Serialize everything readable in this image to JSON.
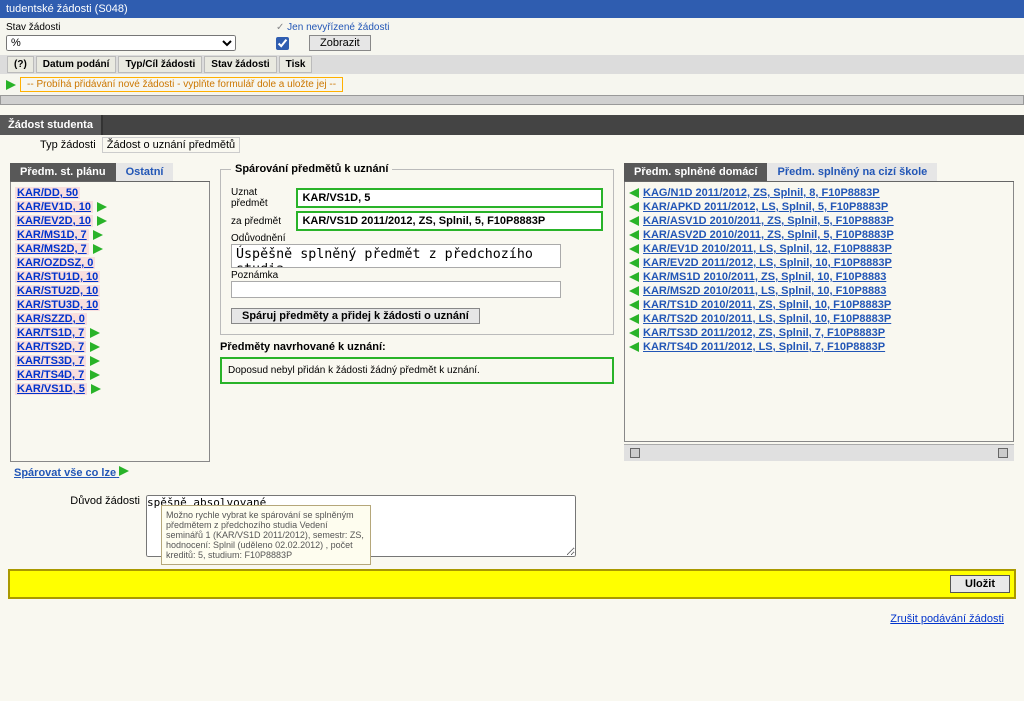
{
  "window_title": "tudentské žádosti (S048)",
  "filter": {
    "state_label": "Stav žádosti",
    "state_value": "%",
    "pending_label": "Jen nevyřízené žádosti",
    "show_btn": "Zobrazit"
  },
  "cols": [
    "(?)",
    "Datum podání",
    "Typ/Cíl žádosti",
    "Stav žádosti",
    "Tisk"
  ],
  "notice": "-- Probíhá přidávání nové žádosti - vyplňte formulář dole a uložte jej --",
  "main_tab": "Žádost studenta",
  "type_label": "Typ žádosti",
  "type_value": "Žádost o uznání předmětů",
  "left": {
    "tab_a": "Předm. st. plánu",
    "tab_b": "Ostatní",
    "items": [
      {
        "t": "KAR/DD, 50",
        "a": false
      },
      {
        "t": "KAR/EV1D, 10",
        "a": true
      },
      {
        "t": "KAR/EV2D, 10",
        "a": true
      },
      {
        "t": "KAR/MS1D, 7",
        "a": true
      },
      {
        "t": "KAR/MS2D, 7",
        "a": true
      },
      {
        "t": "KAR/OZDSZ, 0",
        "a": false
      },
      {
        "t": "KAR/STU1D, 10",
        "a": false
      },
      {
        "t": "KAR/STU2D, 10",
        "a": false
      },
      {
        "t": "KAR/STU3D, 10",
        "a": false
      },
      {
        "t": "KAR/SZZD, 0",
        "a": false
      },
      {
        "t": "KAR/TS1D, 7",
        "a": true
      },
      {
        "t": "KAR/TS2D, 7",
        "a": true
      },
      {
        "t": "KAR/TS3D, 7",
        "a": true
      },
      {
        "t": "KAR/TS4D, 7",
        "a": true
      },
      {
        "t": "KAR/VS1D, 5",
        "a": true
      }
    ],
    "pair_all": "Spárovat vše co lze"
  },
  "pair": {
    "legend": "Spárování předmětů k uznání",
    "recognize_label": "Uznat předmět",
    "recognize_value": "KAR/VS1D, 5",
    "for_label": "za předmět",
    "for_value": "KAR/VS1D 2011/2012, ZS, Splnil, 5, F10P8883P",
    "justif_label": "Odůvodnění",
    "justif_value": "Úspěšně splněný předmět z předchozího studia",
    "note_label": "Poznámka",
    "button": "Spáruj předměty a přidej k žádosti o uznání"
  },
  "proposed": {
    "legend": "Předměty navrhované k uznání:",
    "empty": "Doposud nebyl přidán k žádosti žádný předmět k uznání."
  },
  "right": {
    "tab_a": "Předm. splněné domácí",
    "tab_b": "Předm. splněný na cizí škole",
    "items": [
      "KAG/N1D 2011/2012, ZS, Splnil, 8, F10P8883P",
      "KAR/APKD 2011/2012, LS, Splnil, 5, F10P8883P",
      "KAR/ASV1D 2010/2011, ZS, Splnil, 5, F10P8883P",
      "KAR/ASV2D 2010/2011, ZS, Splnil, 5, F10P8883P",
      "KAR/EV1D 2010/2011, LS, Splnil, 12, F10P8883P",
      "KAR/EV2D 2011/2012, LS, Splnil, 10, F10P8883P",
      "KAR/MS1D 2010/2011, ZS, Splnil, 10, F10P8883",
      "KAR/MS2D 2010/2011, LS, Splnil, 10, F10P8883",
      "KAR/TS1D 2010/2011, ZS, Splnil, 10, F10P8883P",
      "KAR/TS2D 2010/2011, LS, Splnil, 10, F10P8883P",
      "KAR/TS3D 2011/2012, ZS, Splnil, 7, F10P8883P",
      "KAR/TS4D 2011/2012, LS, Splnil, 7, F10P8883P"
    ]
  },
  "tooltip": "Možno rychle vybrat ke spárování se splněným předmětem z předchozího studia Vedení seminářů 1 (KAR/VS1D 2011/2012), semestr: ZS, hodnocení: Splnil (uděleno 02.02.2012) , počet kreditů: 5, studium: F10P8883P",
  "reason_label": "Důvod žádosti",
  "reason_value": "spěšně absolvované",
  "save": "Uložit",
  "cancel": "Zrušit podávání žádosti"
}
